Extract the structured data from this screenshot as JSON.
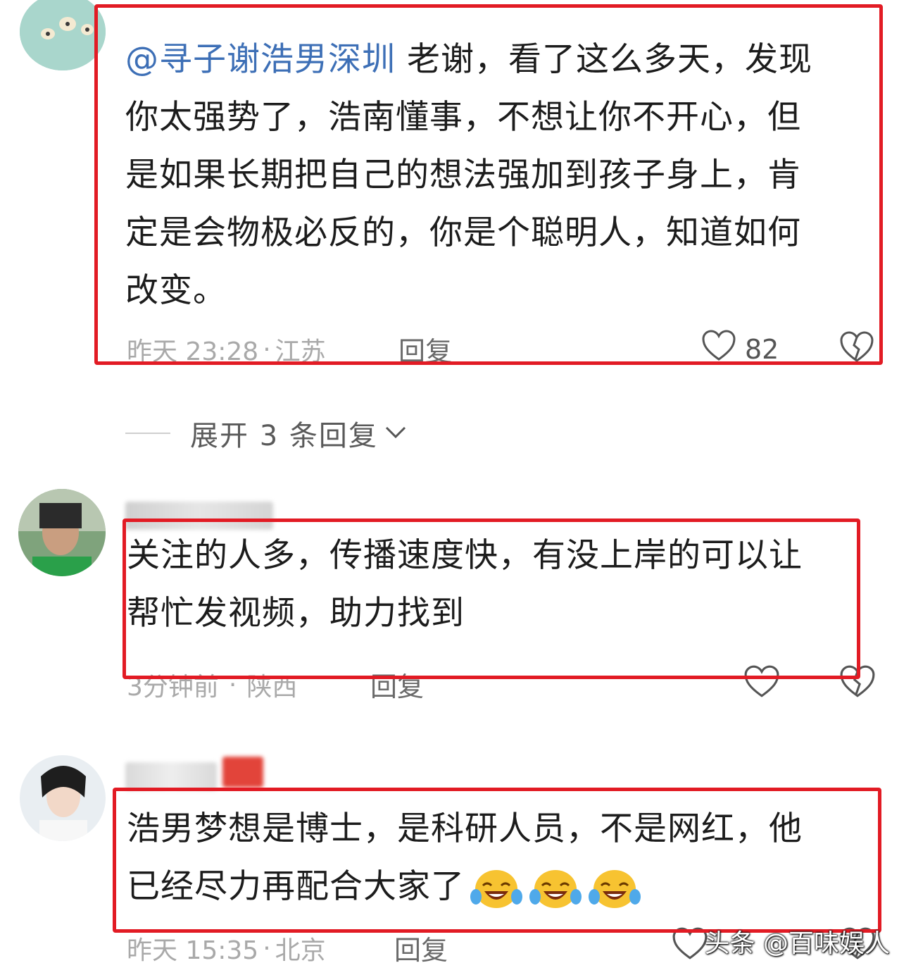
{
  "comments": [
    {
      "mention": "@寻子谢浩男深圳",
      "text_lines": [
        " 老谢，看了这么多天，发现",
        "你太强势了，浩南懂事，不想让你不开心，但",
        "是如果长期把自己的想法强加到孩子身上，肯",
        "定是会物极必反的，你是个聪明人，知道如何",
        "改变。"
      ],
      "time": "昨天 23:28",
      "location": "江苏",
      "reply_label": "回复",
      "like_count": "82"
    },
    {
      "text_lines": [
        "关注的人多，传播速度快，有没上岸的可以让",
        "帮忙发视频，助力找到"
      ],
      "time": "3分钟前",
      "location": "陕西",
      "reply_label": "回复",
      "like_count": ""
    },
    {
      "text_lines": [
        "浩男梦想是博士，是科研人员，不是网红，他",
        "已经尽力再配合大家了"
      ],
      "emoji_names": [
        "laugh-cry-emoji",
        "laugh-cry-emoji",
        "laugh-cry-emoji"
      ],
      "time": "昨天 15:35",
      "location": "北京",
      "reply_label": "回复",
      "like_count": ""
    }
  ],
  "expand_replies": {
    "label": "展开 3 条回复"
  },
  "watermark": "头条 @百味娱人",
  "colors": {
    "highlight": "#e21b24",
    "mention": "#3d6fb6",
    "meta": "#a9a9a9"
  },
  "icons": [
    "heart-outline-icon",
    "broken-heart-icon",
    "chevron-down-icon"
  ]
}
